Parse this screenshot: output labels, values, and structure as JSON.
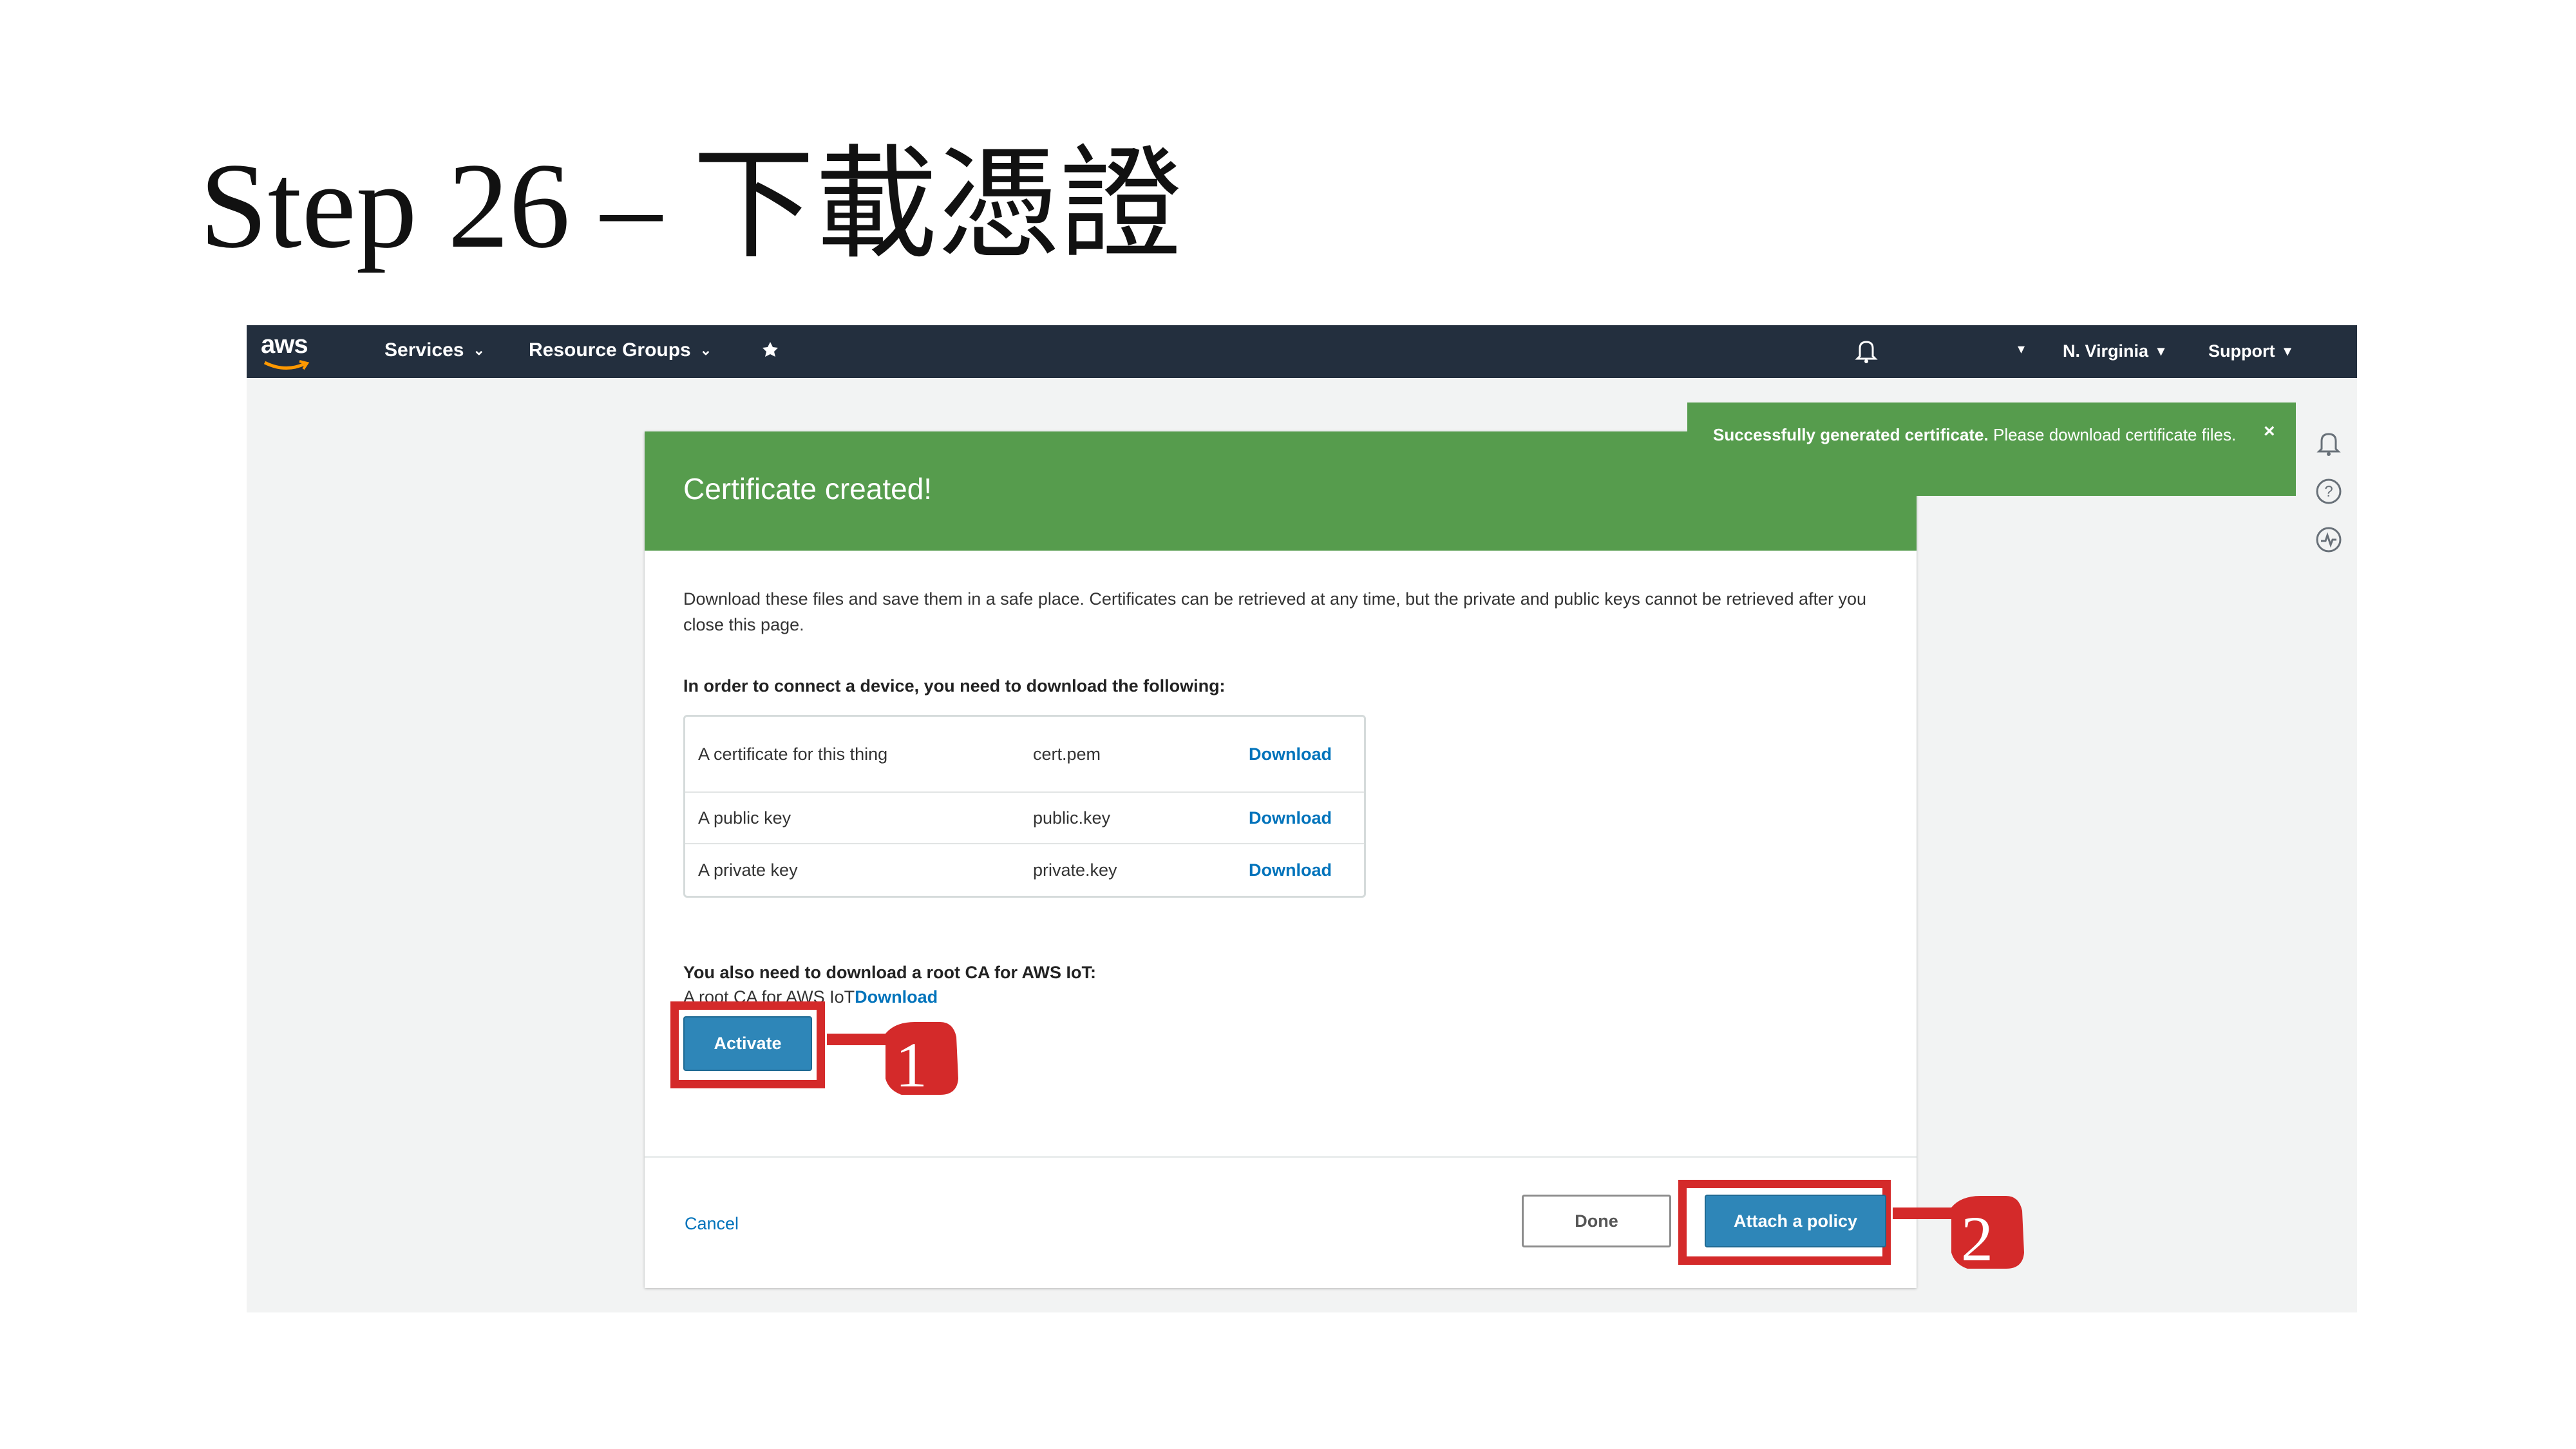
{
  "slide": {
    "title": "Step 26 – 下載憑證"
  },
  "nav": {
    "logo_text": "aws",
    "services": "Services",
    "resource_groups": "Resource Groups",
    "region": "N. Virginia",
    "support": "Support"
  },
  "flash": {
    "strong": "Successfully generated certificate.",
    "text": " Please download certificate files.",
    "close": "×"
  },
  "card": {
    "title": "Certificate created!",
    "intro": "Download these files and save them in a safe place. Certificates can be retrieved at any time, but the private and public keys cannot be retrieved after you close this page.",
    "need_label": "In order to connect a device, you need to download the following:",
    "files": [
      {
        "desc": "A certificate for this thing",
        "name": "cert.pem",
        "link": "Download"
      },
      {
        "desc": "A public key",
        "name": "public.key",
        "link": "Download"
      },
      {
        "desc": "A private key",
        "name": "private.key",
        "link": "Download"
      }
    ],
    "rootca_heading": "You also need to download a root CA for AWS IoT:",
    "rootca_text": "A root CA for AWS IoT",
    "rootca_link": "Download",
    "activate": "Activate",
    "cancel": "Cancel",
    "done": "Done",
    "attach": "Attach a policy"
  },
  "annotations": {
    "step1": "1",
    "step2": "2"
  },
  "colors": {
    "nav": "#232f3e",
    "success": "#569c4d",
    "primary": "#2e86b8",
    "highlight": "#d42a2a",
    "link": "#0073bb"
  }
}
